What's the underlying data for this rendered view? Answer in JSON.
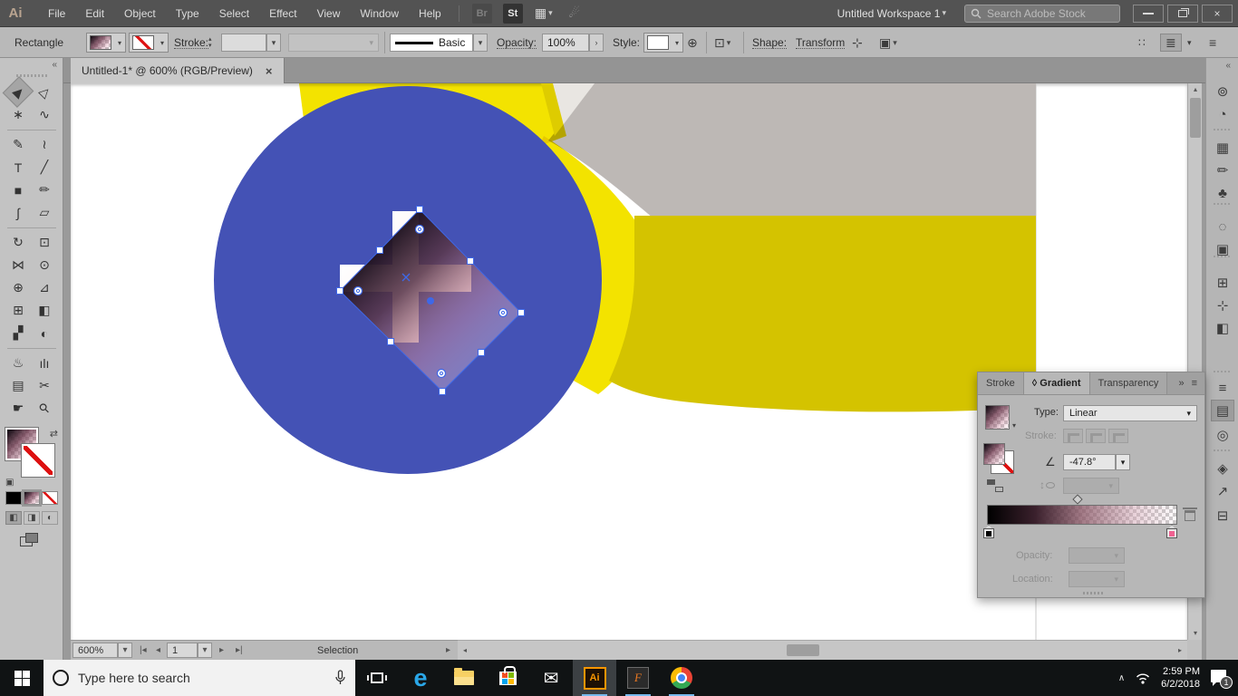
{
  "titlebar": {
    "app_icon": "Ai",
    "menus": [
      "File",
      "Edit",
      "Object",
      "Type",
      "Select",
      "Effect",
      "View",
      "Window",
      "Help"
    ],
    "bridge": "Br",
    "stock": "St",
    "workspace": "Untitled Workspace 1",
    "search_placeholder": "Search Adobe Stock"
  },
  "control_bar": {
    "selection_type": "Rectangle",
    "stroke_label": "Stroke:",
    "brush_name": "Basic",
    "opacity_label": "Opacity:",
    "opacity_value": "100%",
    "style_label": "Style:",
    "shape_label": "Shape:",
    "transform_label": "Transform"
  },
  "document_tab": {
    "title": "Untitled-1* @ 600% (RGB/Preview)",
    "close_glyph": "×"
  },
  "tools": [
    {
      "name": "selection-tool",
      "glyph": "▶",
      "rot": -45,
      "active": true
    },
    {
      "name": "direct-selection-tool",
      "glyph": "▷",
      "rot": -45
    },
    {
      "name": "magic-wand-tool",
      "glyph": "∗"
    },
    {
      "name": "lasso-tool",
      "glyph": "∿"
    },
    {
      "name": "pen-tool",
      "glyph": "✎"
    },
    {
      "name": "curvature-tool",
      "glyph": "≀"
    },
    {
      "name": "type-tool",
      "glyph": "T"
    },
    {
      "name": "line-segment-tool",
      "glyph": "╱"
    },
    {
      "name": "rectangle-tool",
      "glyph": "■"
    },
    {
      "name": "paintbrush-tool",
      "glyph": "✏"
    },
    {
      "name": "shaper-tool",
      "glyph": "∫"
    },
    {
      "name": "eraser-tool",
      "glyph": "▱"
    },
    {
      "name": "rotate-tool",
      "glyph": "↻"
    },
    {
      "name": "scale-tool",
      "glyph": "⊡"
    },
    {
      "name": "width-tool",
      "glyph": "⋈"
    },
    {
      "name": "puppet-warp-tool",
      "glyph": "⊙"
    },
    {
      "name": "shape-builder-tool",
      "glyph": "⊕"
    },
    {
      "name": "perspective-grid-tool",
      "glyph": "⊿"
    },
    {
      "name": "mesh-tool",
      "glyph": "⊞"
    },
    {
      "name": "gradient-tool",
      "glyph": "◧"
    },
    {
      "name": "eyedropper-tool",
      "glyph": "▞"
    },
    {
      "name": "blend-tool",
      "glyph": "◐"
    },
    {
      "name": "symbol-sprayer-tool",
      "glyph": "♨"
    },
    {
      "name": "column-graph-tool",
      "glyph": "ılı"
    },
    {
      "name": "artboard-tool",
      "glyph": "▤"
    },
    {
      "name": "slice-tool",
      "glyph": "✂"
    },
    {
      "name": "hand-tool",
      "glyph": "☛"
    },
    {
      "name": "zoom-tool",
      "glyph": "⚲",
      "rot": -45
    }
  ],
  "right_dock": [
    {
      "name": "color-panel-icon",
      "glyph": "⊚"
    },
    {
      "name": "color-guide-panel-icon",
      "glyph": "◔"
    },
    {
      "name": "swatches-panel-icon",
      "glyph": "▦"
    },
    {
      "name": "brushes-panel-icon",
      "glyph": "✏"
    },
    {
      "name": "symbols-panel-icon",
      "glyph": "♣"
    },
    {
      "name": "appearance-panel-icon",
      "glyph": "◌"
    },
    {
      "name": "graphic-styles-panel-icon",
      "glyph": "▣"
    },
    {
      "name": "transform-panel-icon",
      "glyph": "⊞"
    },
    {
      "name": "align-panel-icon",
      "glyph": "⊹"
    },
    {
      "name": "pathfinder-panel-icon",
      "glyph": "◧"
    },
    {
      "name": "stroke-panel-icon",
      "glyph": "≡"
    },
    {
      "name": "gradient-panel-icon",
      "glyph": "▤",
      "active": true
    },
    {
      "name": "transparency-panel-icon",
      "glyph": "◎"
    },
    {
      "name": "layers-panel-icon",
      "glyph": "◈"
    },
    {
      "name": "asset-export-panel-icon",
      "glyph": "↗"
    },
    {
      "name": "artboards-panel-icon",
      "glyph": "⊟"
    }
  ],
  "gradient_panel": {
    "tab_stroke": "Stroke",
    "tab_gradient": "Gradient",
    "tab_transparency": "Transparency",
    "tab_gradient_glyph": "◊",
    "type_label": "Type:",
    "type_value": "Linear",
    "stroke_label": "Stroke:",
    "angle_value": "-47.8°",
    "opacity_label": "Opacity:",
    "location_label": "Location:"
  },
  "status_bar": {
    "zoom": "600%",
    "artboard_number": "1",
    "status": "Selection"
  },
  "taskbar": {
    "search_placeholder": "Type here to search",
    "apps": [
      "edge",
      "file-explorer",
      "store",
      "mail",
      "illustrator",
      "fuse",
      "chrome"
    ],
    "time": "2:59 PM",
    "date": "6/2/2018",
    "notification_count": "1"
  },
  "canvas": {
    "colors": {
      "blue": "#4452b5",
      "yellow": "#f3e300",
      "olive_band": "#d4c300",
      "gray": "#bdb8b5",
      "light_wedge": "#e9e6e2",
      "selection": "#3e68e8",
      "artboard_edge": "#c9c9c9"
    },
    "gradient": {
      "stops": [
        {
          "color": "#0d0713",
          "opacity": "1"
        },
        {
          "color": "#5a374b",
          "opacity": "0.88"
        },
        {
          "color": "#cd8ca0",
          "opacity": "0.5"
        },
        {
          "color": "#f3d6e0",
          "opacity": "0.32"
        }
      ],
      "cross": [
        {
          "color": "#ffffff"
        },
        {
          "color": "#f4dadd"
        }
      ]
    }
  }
}
